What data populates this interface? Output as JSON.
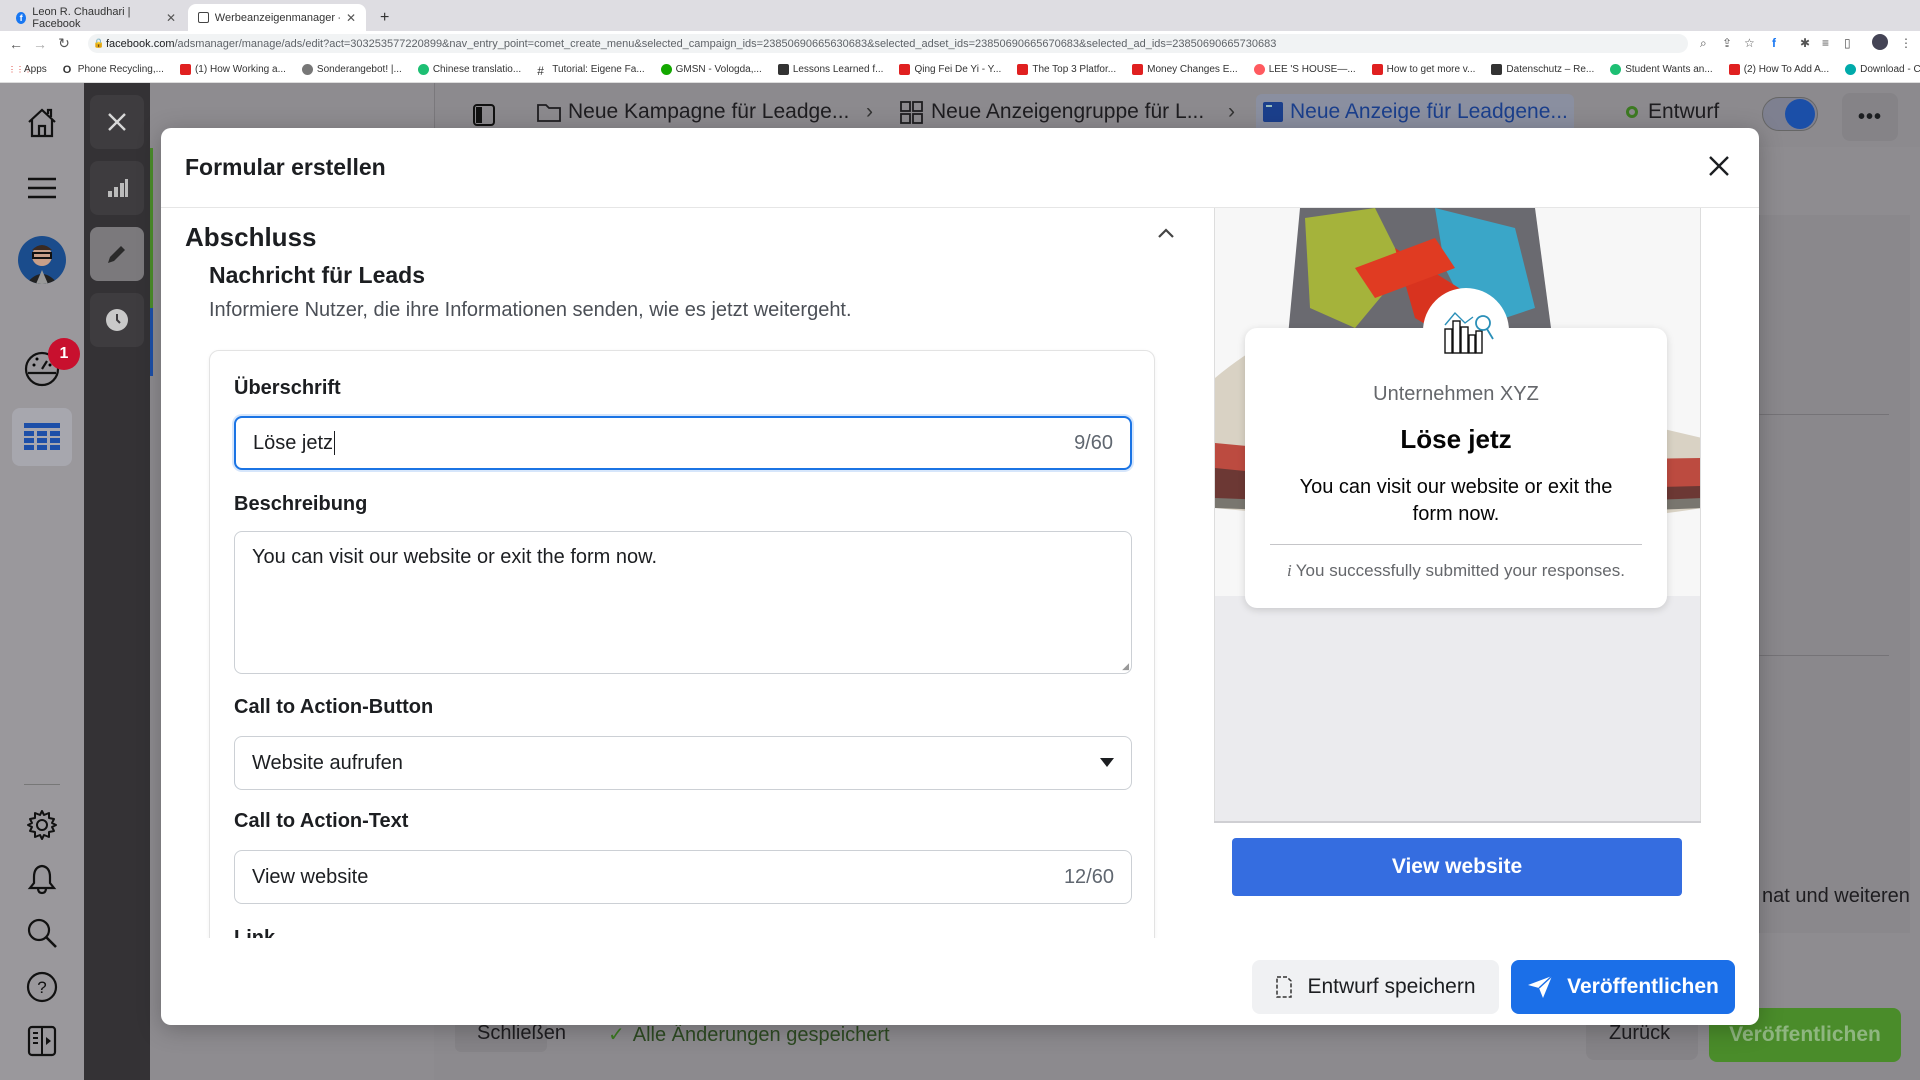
{
  "browser": {
    "tabs": [
      {
        "label": "Leon R. Chaudhari | Facebook",
        "icon": "facebook-icon",
        "active": false
      },
      {
        "label": "Werbeanzeigenmanager - Wer",
        "icon": "adsmanager-icon",
        "active": true
      }
    ],
    "new_tab": "+",
    "url_domain": "facebook.com",
    "url_path": "/adsmanager/manage/ads/edit?act=303253577220899&nav_entry_point=comet_create_menu&selected_campaign_ids=23850690665630683&selected_adset_ids=23850690665670683&selected_ad_ids=23850690665730683",
    "bookmarks": [
      {
        "label": "Apps",
        "icon": "apps-grid-icon",
        "color": "#d93025"
      },
      {
        "label": "Phone Recycling,...",
        "icon": "o2-icon",
        "color": "#1a1a1a"
      },
      {
        "label": "(1) How Working a...",
        "icon": "youtube-icon",
        "color": "#e02020"
      },
      {
        "label": "Sonderangebot! |...",
        "icon": "check-circle-icon",
        "color": "#777"
      },
      {
        "label": "Chinese translatio...",
        "icon": "fiverr-icon",
        "color": "#1dbf73"
      },
      {
        "label": "Tutorial: Eigene Fa...",
        "icon": "hash-icon",
        "color": "#333"
      },
      {
        "label": "GMSN - Vologda,...",
        "icon": "upwork-icon",
        "color": "#14a800"
      },
      {
        "label": "Lessons Learned f...",
        "icon": "er-icon",
        "color": "#333"
      },
      {
        "label": "Qing Fei De Yi - Y...",
        "icon": "youtube-icon",
        "color": "#e02020"
      },
      {
        "label": "The Top 3 Platfor...",
        "icon": "youtube-icon",
        "color": "#e02020"
      },
      {
        "label": "Money Changes E...",
        "icon": "youtube-icon",
        "color": "#e02020"
      },
      {
        "label": "LEE 'S HOUSE—...",
        "icon": "airbnb-icon",
        "color": "#ff5a5f"
      },
      {
        "label": "How to get more v...",
        "icon": "youtube-icon",
        "color": "#e02020"
      },
      {
        "label": "Datenschutz – Re...",
        "icon": "datenschutz-icon",
        "color": "#333"
      },
      {
        "label": "Student Wants an...",
        "icon": "green-circle-icon",
        "color": "#1dbf73"
      },
      {
        "label": "(2) How To Add A...",
        "icon": "youtube-icon",
        "color": "#e02020"
      },
      {
        "label": "Download - Cooki...",
        "icon": "cookie-icon",
        "color": "#0aa"
      }
    ],
    "more_bookmarks": "»"
  },
  "app": {
    "rail": {
      "notification_badge": "1",
      "icons": [
        "home-icon",
        "menu-icon",
        "avatar",
        "dashboard-icon",
        "grid-table-icon",
        "settings-icon",
        "bell-icon",
        "search-icon",
        "help-icon",
        "panel-toggle-icon"
      ]
    },
    "breadcrumbs": [
      {
        "label": "Neue Kampagne für Leadge...",
        "icon": "folder-icon"
      },
      {
        "label": "Neue Anzeigengruppe für L...",
        "icon": "grid-icon"
      },
      {
        "label": "Neue Anzeige für Leadgene...",
        "icon": "ad-icon",
        "active": true
      }
    ],
    "status": "Entwurf",
    "bottom": {
      "close_label": "Schließen",
      "saved_status": "Alle Änderungen gespeichert",
      "back_label": "Zurück",
      "publish_label": "Veröffentlichen",
      "partial_text": "nat und weiteren"
    }
  },
  "modal": {
    "title": "Formular erstellen",
    "section_title": "Abschluss",
    "subsection_title": "Nachricht für Leads",
    "subsection_desc": "Informiere Nutzer, die ihre Informationen senden, wie es jetzt weitergeht.",
    "fields": {
      "headline": {
        "label": "Überschrift",
        "value": "Löse jetz",
        "count": "9/60"
      },
      "description": {
        "label": "Beschreibung",
        "value": "You can visit our website or exit the form now."
      },
      "cta_button": {
        "label": "Call to Action-Button",
        "value": "Website aufrufen"
      },
      "cta_text": {
        "label": "Call to Action-Text",
        "value": "View website",
        "count": "12/60"
      },
      "link": {
        "label": "Link"
      }
    },
    "preview": {
      "company": "Unternehmen XYZ",
      "headline": "Löse jetz",
      "description": "You can visit our website or exit the form now.",
      "success_icon": "i",
      "success_text": "You successfully submitted your responses.",
      "cta_label": "View website"
    },
    "footer": {
      "save_draft_label": "Entwurf speichern",
      "publish_label": "Veröffentlichen"
    }
  },
  "colors": {
    "primary_blue": "#1b6fe8",
    "preview_cta_blue": "#356de0",
    "publish_green": "#4a8c2a",
    "status_green": "#42b72a",
    "badge_red": "#c8102e"
  }
}
